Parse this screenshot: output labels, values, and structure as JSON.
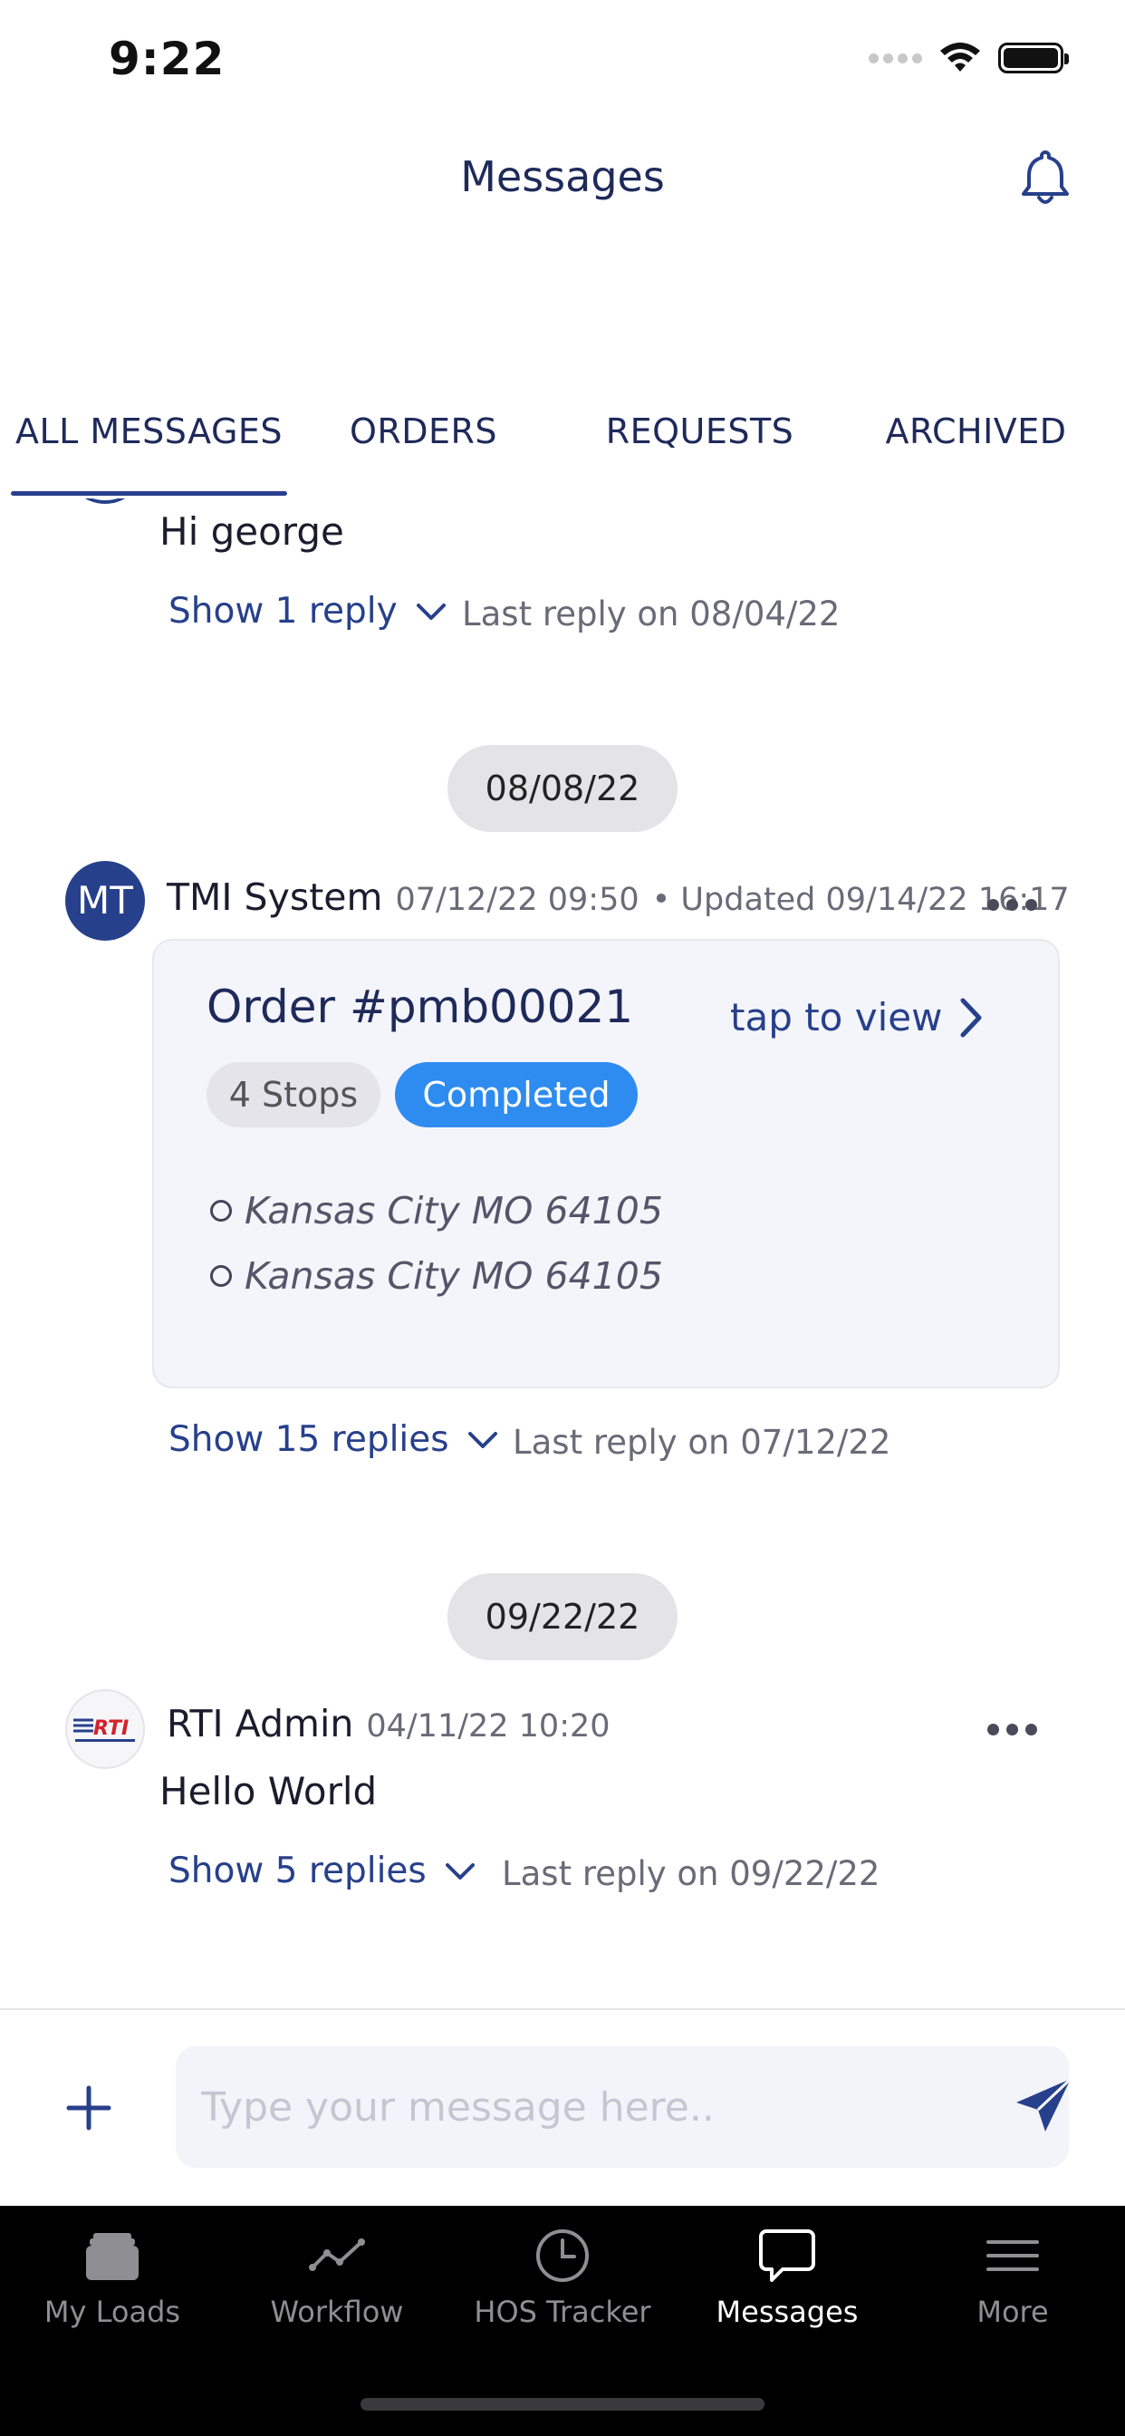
{
  "status_bar": {
    "time": "9:22"
  },
  "header": {
    "title": "Messages"
  },
  "tabs": [
    {
      "label": "ALL MESSAGES",
      "active": true
    },
    {
      "label": "ORDERS",
      "active": false
    },
    {
      "label": "REQUESTS",
      "active": false
    },
    {
      "label": "ARCHIVED",
      "active": false
    }
  ],
  "feed": {
    "thread0": {
      "text": "Hi george",
      "replies_label": "Show 1 reply",
      "last_reply": "Last reply on 08/04/22"
    },
    "date1": "08/08/22",
    "thread1": {
      "avatar_initials": "MT",
      "sender": "TMI System",
      "timestamp": "07/12/22 09:50",
      "updated": "• Updated 09/14/22 16:17",
      "order": {
        "title": "Order #pmb00021",
        "tap_label": "tap to view",
        "stops_badge": "4 Stops",
        "status_badge": "Completed",
        "stops": [
          "Kansas City MO 64105",
          "Kansas City MO 64105"
        ]
      },
      "replies_label": "Show 15 replies",
      "last_reply": "Last reply on 07/12/22"
    },
    "date2": "09/22/22",
    "thread2": {
      "avatar_text": "RTI",
      "sender": "RTI Admin",
      "timestamp": "04/11/22 10:20",
      "text": "Hello World",
      "replies_label": "Show 5 replies",
      "last_reply": "Last reply on 09/22/22"
    }
  },
  "composer": {
    "placeholder": "Type your message here.."
  },
  "tabbar": [
    {
      "label": "My Loads",
      "icon": "layers-icon",
      "active": false
    },
    {
      "label": "Workflow",
      "icon": "workflow-icon",
      "active": false
    },
    {
      "label": "HOS Tracker",
      "icon": "clock-icon",
      "active": false
    },
    {
      "label": "Messages",
      "icon": "chat-bubble-icon",
      "active": true
    },
    {
      "label": "More",
      "icon": "menu-icon",
      "active": false
    }
  ],
  "colors": {
    "navy": "#1e2a5a",
    "link_blue": "#27408b",
    "badge_blue": "#2e8bf0",
    "pill_grey": "#e4e4e6",
    "tabbar_bg": "#000000"
  }
}
